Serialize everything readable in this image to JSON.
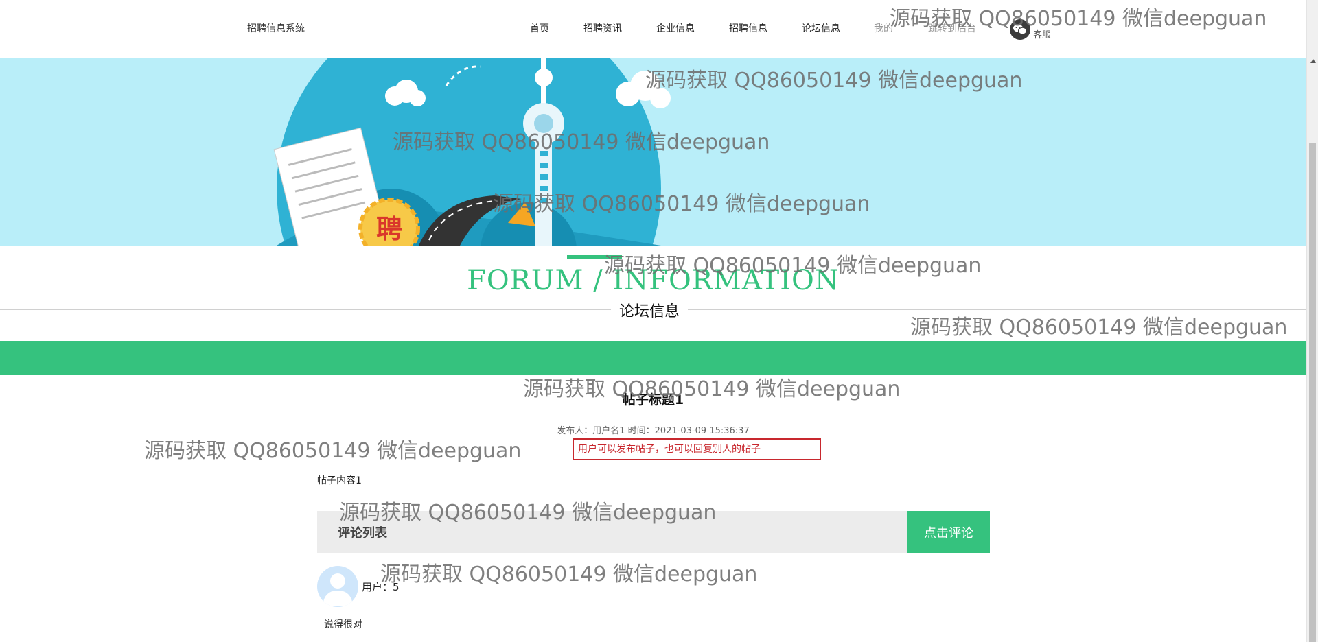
{
  "header": {
    "brand": "招聘信息系统",
    "nav": [
      {
        "label": "首页",
        "muted": false
      },
      {
        "label": "招聘资讯",
        "muted": false
      },
      {
        "label": "企业信息",
        "muted": false
      },
      {
        "label": "招聘信息",
        "muted": false
      },
      {
        "label": "论坛信息",
        "muted": false
      },
      {
        "label": "我的",
        "muted": true
      },
      {
        "label": "跳转到后台",
        "muted": true
      }
    ],
    "service_label": "客服",
    "service_icon": "wechat-icon"
  },
  "banner": {
    "badge_text": "聘",
    "illustration": "city-tower-recruitment"
  },
  "section": {
    "title_en": "FORUM / INFORMATION",
    "title_cn": "论坛信息"
  },
  "post": {
    "title": "帖子标题1",
    "meta": "发布人：用户名1 时间：2021-03-09 15:36:37",
    "annotation": "用户可以发布帖子，也可以回复别人的帖子",
    "body": "帖子内容1"
  },
  "comments": {
    "header": "评论列表",
    "button_label": "点击评论",
    "items": [
      {
        "user": "用户：5",
        "text": "说得很对"
      }
    ]
  },
  "watermark": "源码获取 QQ86050149 微信deepguan",
  "colors": {
    "accent": "#35c27e",
    "banner": "#b9eef9",
    "annotation": "#c8282e"
  }
}
